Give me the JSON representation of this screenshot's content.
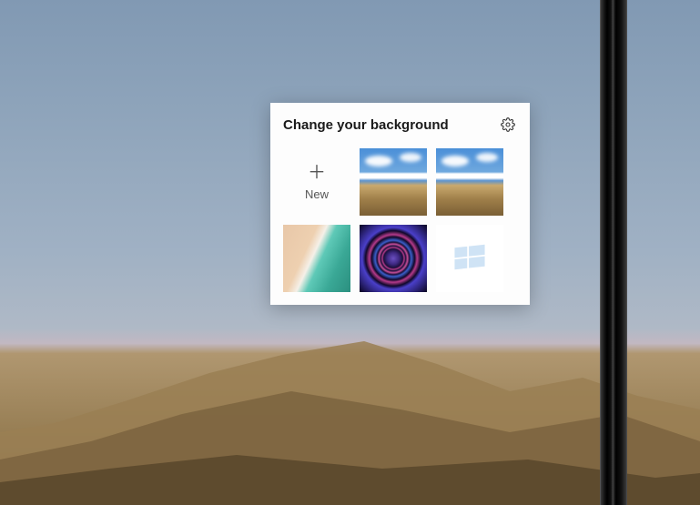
{
  "panel": {
    "title": "Change your background",
    "new_label": "New"
  },
  "thumbnails": {
    "0": {
      "name": "new-background"
    },
    "1": {
      "name": "desert-sky-1"
    },
    "2": {
      "name": "desert-sky-2"
    },
    "3": {
      "name": "beach-aerial"
    },
    "4": {
      "name": "rose-window"
    },
    "5": {
      "name": "windows-logo"
    }
  }
}
